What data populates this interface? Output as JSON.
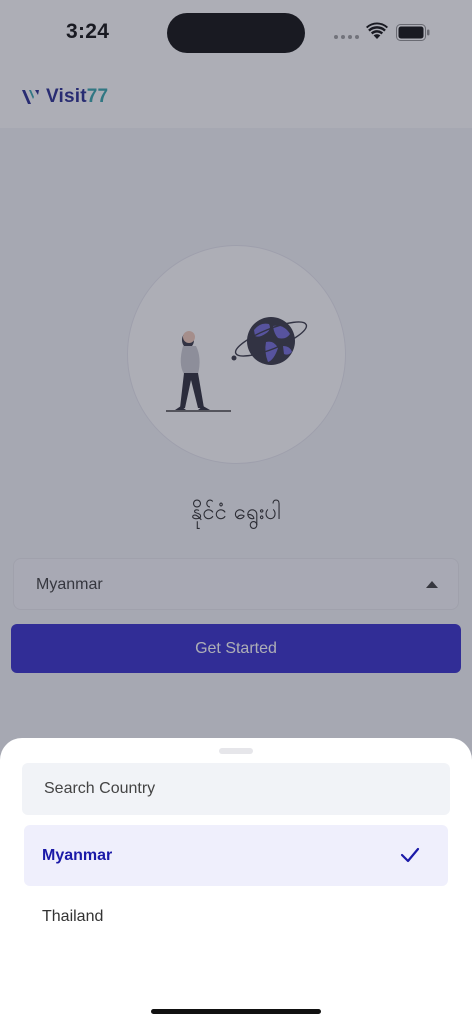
{
  "status_bar": {
    "time": "3:24"
  },
  "header": {
    "logo_text_main": "Visit",
    "logo_text_accent": "77"
  },
  "main": {
    "choose_country_label": "နိုင်ငံ ရွေးပါ",
    "dropdown_value": "Myanmar",
    "get_started_label": "Get Started"
  },
  "sheet": {
    "search_placeholder": "Search Country",
    "options": [
      {
        "label": "Myanmar",
        "selected": true
      },
      {
        "label": "Thailand",
        "selected": false
      }
    ]
  },
  "icons": {
    "wifi": "wifi-icon",
    "battery": "battery-icon",
    "dropdown_arrow": "caret-up-icon",
    "check": "check-icon"
  },
  "colors": {
    "brand_primary": "#2a22c8",
    "brand_accent": "#2aa0a8",
    "selected_text": "#1b1aa8",
    "selected_bg": "#efeffc"
  }
}
